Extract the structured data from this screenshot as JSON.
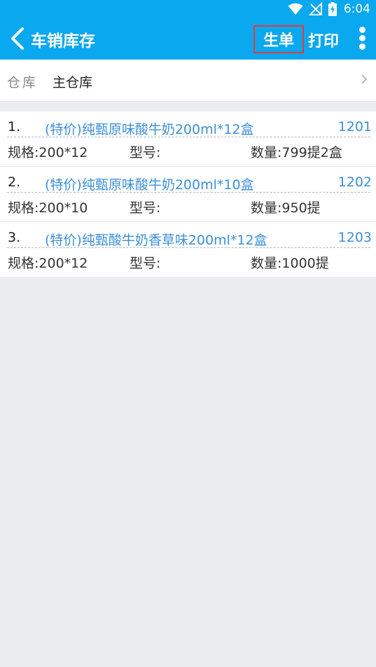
{
  "status_bar": {
    "time": "6:04"
  },
  "header": {
    "title": "车销库存",
    "generate_label": "生单",
    "print_label": "打印"
  },
  "warehouse": {
    "label": "仓库",
    "value": "主仓库"
  },
  "items": [
    {
      "index": "1.",
      "name": "(特价)纯甄原味酸牛奶200ml*12盒",
      "code": "1201",
      "spec": "规格:200*12",
      "model": "型号:",
      "quantity": "数量:799提2盒"
    },
    {
      "index": "2.",
      "name": "(特价)纯甄原味酸牛奶200ml*10盒",
      "code": "1202",
      "spec": "规格:200*10",
      "model": "型号:",
      "quantity": "数量:950提"
    },
    {
      "index": "3.",
      "name": "(特价)纯甄酸牛奶香草味200ml*12盒",
      "code": "1203",
      "spec": "规格:200*12",
      "model": "型号:",
      "quantity": "数量:1000提"
    }
  ],
  "colors": {
    "primary": "#0aa8ee",
    "link": "#3c8fd8",
    "highlight_border": "#e5383b",
    "background": "#e9eded"
  },
  "icons": [
    "wifi-icon",
    "no-signal-icon",
    "battery-charging-icon",
    "back-arrow-icon",
    "more-vert-icon",
    "chevron-right-icon"
  ]
}
